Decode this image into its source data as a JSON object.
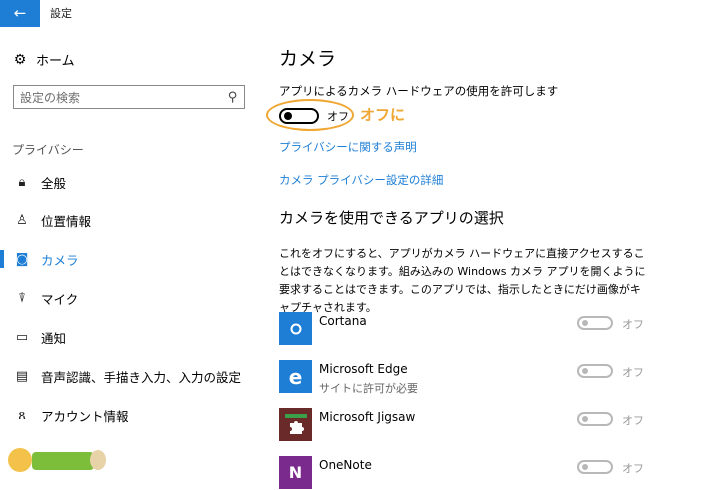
{
  "window": {
    "title": "設定"
  },
  "sidebar": {
    "home": "ホーム",
    "search_placeholder": "設定の検索",
    "section": "プライバシー",
    "items": [
      {
        "label": "全般",
        "icon": "lock-icon"
      },
      {
        "label": "位置情報",
        "icon": "location-icon"
      },
      {
        "label": "カメラ",
        "icon": "camera-icon",
        "active": true
      },
      {
        "label": "マイク",
        "icon": "microphone-icon"
      },
      {
        "label": "通知",
        "icon": "notification-icon"
      },
      {
        "label": "音声認識、手描き入力、入力の設定",
        "icon": "clipboard-icon"
      },
      {
        "label": "アカウント情報",
        "icon": "account-info-icon"
      }
    ]
  },
  "main": {
    "title": "カメラ",
    "allow_text": "アプリによるカメラ ハードウェアの使用を許可します",
    "toggle_state": "オフ",
    "annotation": "オフに",
    "links": [
      "プライバシーに関する声明",
      "カメラ プライバシー設定の詳細"
    ],
    "apps_heading": "カメラを使用できるアプリの選択",
    "description": "これをオフにすると、アプリがカメラ ハードウェアに直接アクセスすることはできなくなります。組み込みの Windows カメラ アプリを開くように要求することはできます。このアプリでは、指示したときにだけ画像がキャプチャされます。",
    "apps": [
      {
        "name": "Cortana",
        "sub": "",
        "state": "オフ",
        "color": "#1e7ed6"
      },
      {
        "name": "Microsoft Edge",
        "sub": "サイトに許可が必要",
        "state": "オフ",
        "color": "#1e7ed6"
      },
      {
        "name": "Microsoft Jigsaw",
        "sub": "",
        "state": "オフ",
        "color": "#6b2a2a"
      },
      {
        "name": "OneNote",
        "sub": "",
        "state": "オフ",
        "color": "#7a2a8c"
      }
    ]
  },
  "colors": {
    "accent": "#1e7ed6",
    "annotation": "#f0a632"
  }
}
